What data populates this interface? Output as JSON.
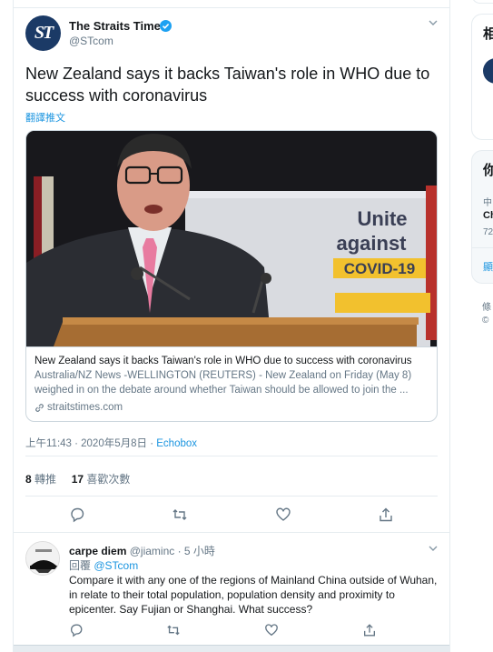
{
  "tweet": {
    "author_name": "The Straits Times",
    "author_handle": "@STcom",
    "avatar_text": "ST",
    "text": "New Zealand says it backs Taiwan's role in WHO due to success with coronavirus",
    "translate_label": "翻譯推文",
    "card": {
      "image_sign_line1": "Unite",
      "image_sign_line2": "against",
      "image_sign_line3": "COVID-19",
      "title": "New Zealand says it backs Taiwan's role in WHO due to success with coronavirus",
      "description": "Australia/NZ News -WELLINGTON (REUTERS) - New Zealand on Friday (May 8) weighed in on the debate around whether Taiwan should be allowed to join the ...",
      "domain": "straitstimes.com"
    },
    "timestamp": "上午11:43 · 2020年5月8日 · ",
    "source": "Echobox",
    "retweets_count": "8",
    "retweets_label": "轉推",
    "likes_count": "17",
    "likes_label": "喜歡次數"
  },
  "reply": {
    "author_name": "carpe diem",
    "author_handle": "@jiaminc",
    "time": " · 5 小時",
    "replying_to_label": "回覆 ",
    "replying_to_handle": "@STcom",
    "text": "Compare it with any one of the regions of Mainland China outside of Wuhan, in relate to their total population, population density and proximity to epicenter. Say Fujian or Shanghai. What success?"
  },
  "sidebar": {
    "box1_title": "相",
    "box2_title": "你",
    "trend_category": "中",
    "trend_name": "Ch",
    "trend_count": "72",
    "show_more": "顯",
    "footer1": "條",
    "footer2": "©"
  },
  "colors": {
    "accent": "#1da1f2",
    "link": "#1b95e0",
    "secondary_text": "#657786",
    "covid_yellow": "#f2c12e"
  }
}
